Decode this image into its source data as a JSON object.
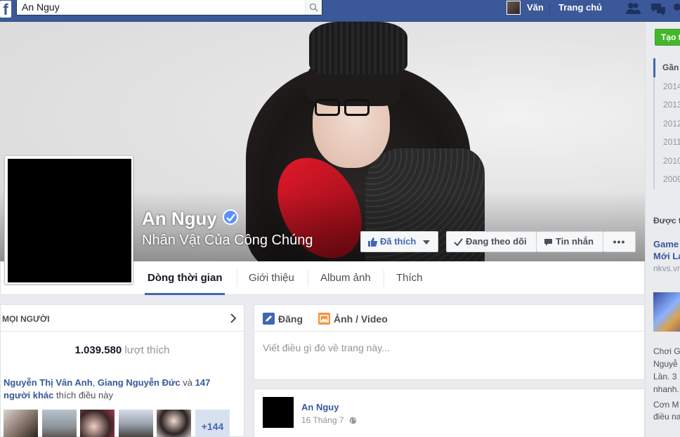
{
  "topbar": {
    "logo": "f",
    "search_value": "An Nguy",
    "user_name": "Văn",
    "home_label": "Trang chủ",
    "icons": [
      "search-icon",
      "friend-requests-icon",
      "messages-icon",
      "notifications-icon"
    ]
  },
  "profile": {
    "name": "An Nguy",
    "category": "Nhân Vật Của Công Chúng",
    "verified": true,
    "verified_color": "#5890ff"
  },
  "cover_buttons": {
    "liked": "Đã thích",
    "following": "Đang theo dõi",
    "message": "Tin nhắn",
    "more": "•••"
  },
  "tabs": [
    {
      "label": "Dòng thời gian",
      "active": true
    },
    {
      "label": "Giới thiệu",
      "active": false
    },
    {
      "label": "Album ảnh",
      "active": false
    },
    {
      "label": "Thích",
      "active": false
    }
  ],
  "people": {
    "header": "MỌI NGƯỜI",
    "likes_number": "1.039.580",
    "likes_label": "lượt thích",
    "friend1": "Nguyễn Thị Vân Anh",
    "friend2": "Giang Nguyễn Đức",
    "and": "và",
    "others": "147 người khác",
    "suffix": "thích điều này",
    "more_count": "+144"
  },
  "composer": {
    "post_tab": "Đăng",
    "photo_tab": "Ảnh / Video",
    "placeholder": "Viết điều gì đó về trang này..."
  },
  "post": {
    "author": "An Nguy",
    "time": "16 Tháng 7"
  },
  "rail": {
    "create_label": "Tạo t",
    "years": [
      "Gần",
      "2014",
      "2013",
      "2012",
      "2011",
      "2010",
      "2009"
    ],
    "sponsored": "Được t",
    "ad_title_1": "Game",
    "ad_title_2": "Mới La",
    "ad_url": "nkvs.vn",
    "ad_text": [
      "Chơi G",
      "Nguyễ",
      "Lần. 3",
      "nhanh."
    ],
    "ad_text2": [
      "Cơn M",
      "điều na"
    ]
  },
  "colors": {
    "brand": "#3b5998",
    "link": "#365899",
    "create_green": "#42b72a",
    "tab_active": "#4267b2"
  }
}
